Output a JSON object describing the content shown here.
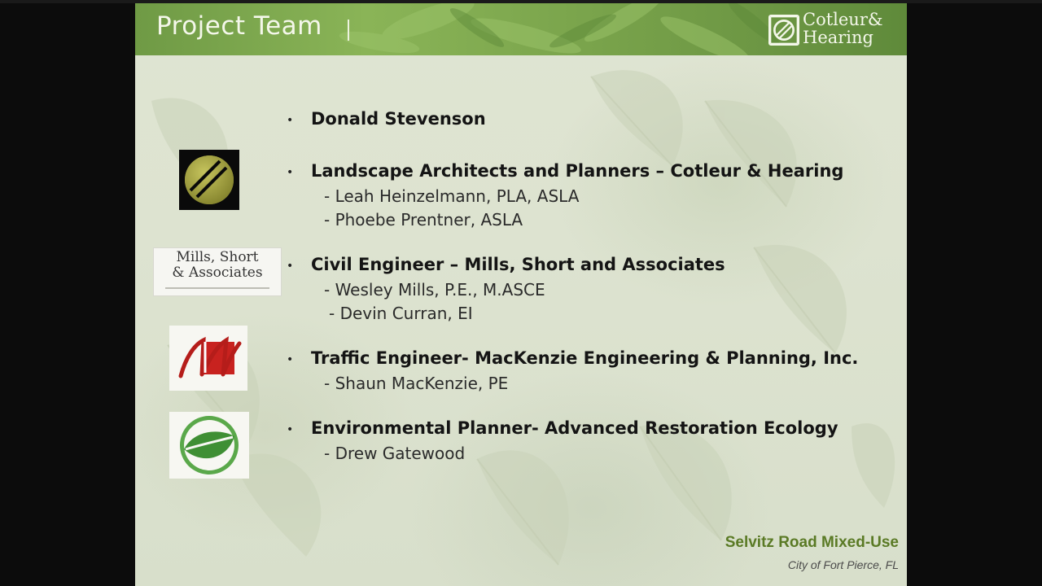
{
  "slide": {
    "title": "Project Team",
    "brand": {
      "line1": "Cotleur&",
      "line2": "Hearing"
    },
    "items": [
      {
        "title": "Donald Stevenson",
        "subs": []
      },
      {
        "title": "Landscape Architects and Planners – Cotleur & Hearing",
        "subs": [
          "- Leah Heinzelmann, PLA, ASLA",
          "- Phoebe Prentner, ASLA"
        ]
      },
      {
        "title": "Civil Engineer – Mills, Short and Associates",
        "subs": [
          "- Wesley Mills, P.E., M.ASCE",
          "- Devin Curran, EI"
        ]
      },
      {
        "title": "Traffic Engineer- MacKenzie Engineering & Planning, Inc.",
        "subs": [
          "- Shaun MacKenzie, PE"
        ]
      },
      {
        "title": "Environmental Planner- Advanced Restoration Ecology",
        "subs": [
          "- Drew Gatewood"
        ]
      }
    ],
    "logos": {
      "cotleur": {
        "icon": "cotleur-hearing-logo-icon"
      },
      "mills": {
        "line1": "Mills, Short",
        "line2": "& Associates",
        "icon": "mills-short-logo-icon"
      },
      "mackenzie": {
        "icon": "mackenzie-logo-icon"
      },
      "are": {
        "icon": "advanced-restoration-ecology-logo-icon"
      }
    },
    "footer": {
      "project": "Selvitz Road Mixed-Use",
      "location": "City of Fort Pierce, FL"
    },
    "colors": {
      "header_green": "#7aa44c",
      "footer_green": "#5a7a25",
      "mackenzie_red": "#c8221f",
      "are_green": "#4a9a3a"
    }
  }
}
